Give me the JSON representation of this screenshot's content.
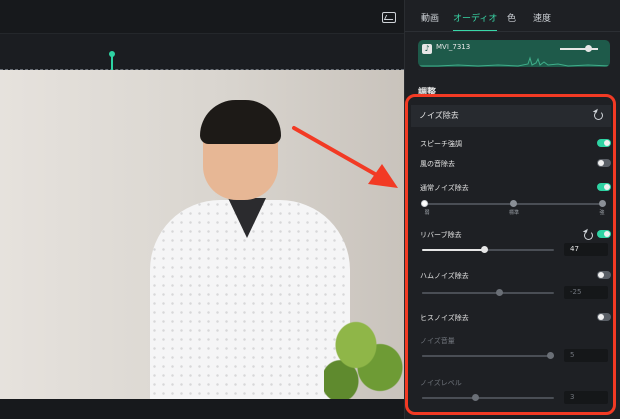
{
  "tabs": [
    {
      "label": "動画"
    },
    {
      "label": "オーディオ",
      "active": true
    },
    {
      "label": "色"
    },
    {
      "label": "速度"
    }
  ],
  "clip": {
    "name": "MVI_7313"
  },
  "section": {
    "title": "調整"
  },
  "noise": {
    "title": "ノイズ除去",
    "speech": {
      "label": "スピーチ強調",
      "on": true
    },
    "wind": {
      "label": "風の音除去",
      "on": false
    },
    "normal": {
      "label": "通常ノイズ除去",
      "on": true,
      "levels": [
        "弱",
        "標準",
        "強"
      ],
      "selected": 0
    },
    "reverb": {
      "label": "リバーブ除去",
      "on": true,
      "value": "47",
      "fraction": 0.47
    },
    "hum": {
      "label": "ハムノイズ除去",
      "on": false,
      "value": "-25",
      "fraction": 0.58
    },
    "hiss": {
      "label": "ヒスノイズ除去",
      "on": false
    },
    "noise_volume": {
      "label": "ノイズ音量",
      "value": "5",
      "fraction": 0.97
    },
    "noise_level": {
      "label": "ノイズレベル",
      "value": "3",
      "fraction": 0.4
    }
  },
  "colors": {
    "accent": "#2ed3a3",
    "highlight": "#f23a24"
  },
  "icons": [
    "snapshot-icon",
    "music-icon",
    "reset-icon"
  ]
}
